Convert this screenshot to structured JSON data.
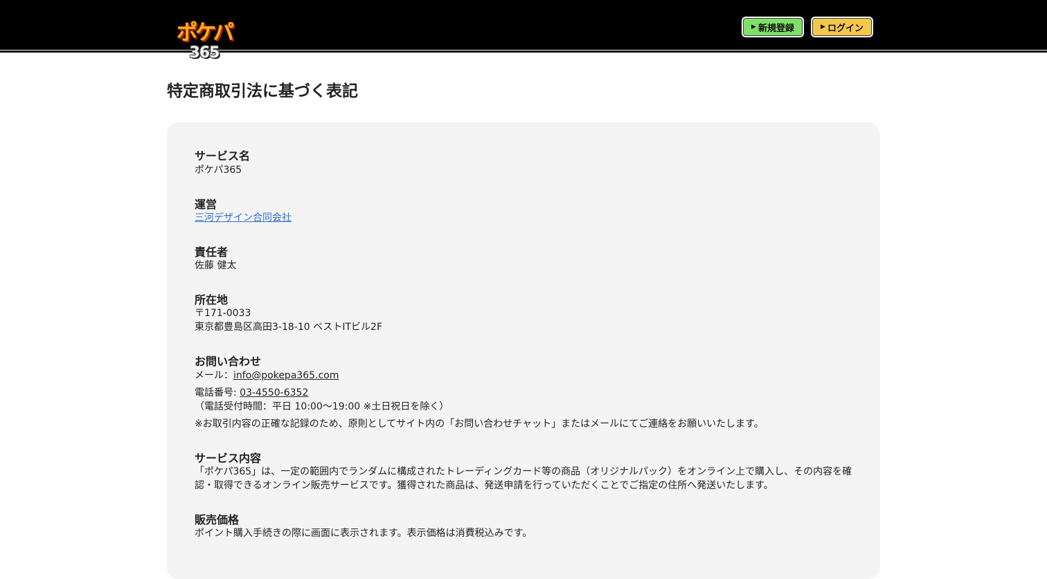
{
  "header": {
    "logo_text": "ポケパ",
    "logo_number": "365",
    "register_label": "新規登録",
    "login_label": "ログイン",
    "button_arrow": "▶"
  },
  "page": {
    "title": "特定商取引法に基づく表記"
  },
  "sections": {
    "service_name": {
      "heading": "サービス名",
      "value": "ポケパ365"
    },
    "operator": {
      "heading": "運営",
      "value": "三河デザイン合同会社"
    },
    "responsible": {
      "heading": "責任者",
      "value": "佐藤 健太"
    },
    "address": {
      "heading": "所在地",
      "postal": "〒171-0033",
      "line": "東京都豊島区高田3-18-10 ベストITビル2F"
    },
    "contact": {
      "heading": "お問い合わせ",
      "mail_label": "メール：",
      "mail": "info@pokepa365.com",
      "phone_label": "電話番号: ",
      "phone": "03-4550-6352",
      "hours": "（電話受付時間：平日 10:00〜19:00 ※土日祝日を除く）",
      "note": "※お取引内容の正確な記録のため、原則としてサイト内の「お問い合わせチャット」またはメールにてご連絡をお願いいたします。"
    },
    "service_content": {
      "heading": "サービス内容",
      "text": "「ポケパ365」は、一定の範囲内でランダムに構成されたトレーディングカード等の商品（オリジナルパック）をオンライン上で購入し、その内容を確認・取得できるオンライン販売サービスです。獲得された商品は、発送申請を行っていただくことでご指定の住所へ発送いたします。"
    },
    "price": {
      "heading": "販売価格",
      "text": "ポイント購入手続きの際に画面に表示されます。表示価格は消費税込みです。"
    }
  }
}
